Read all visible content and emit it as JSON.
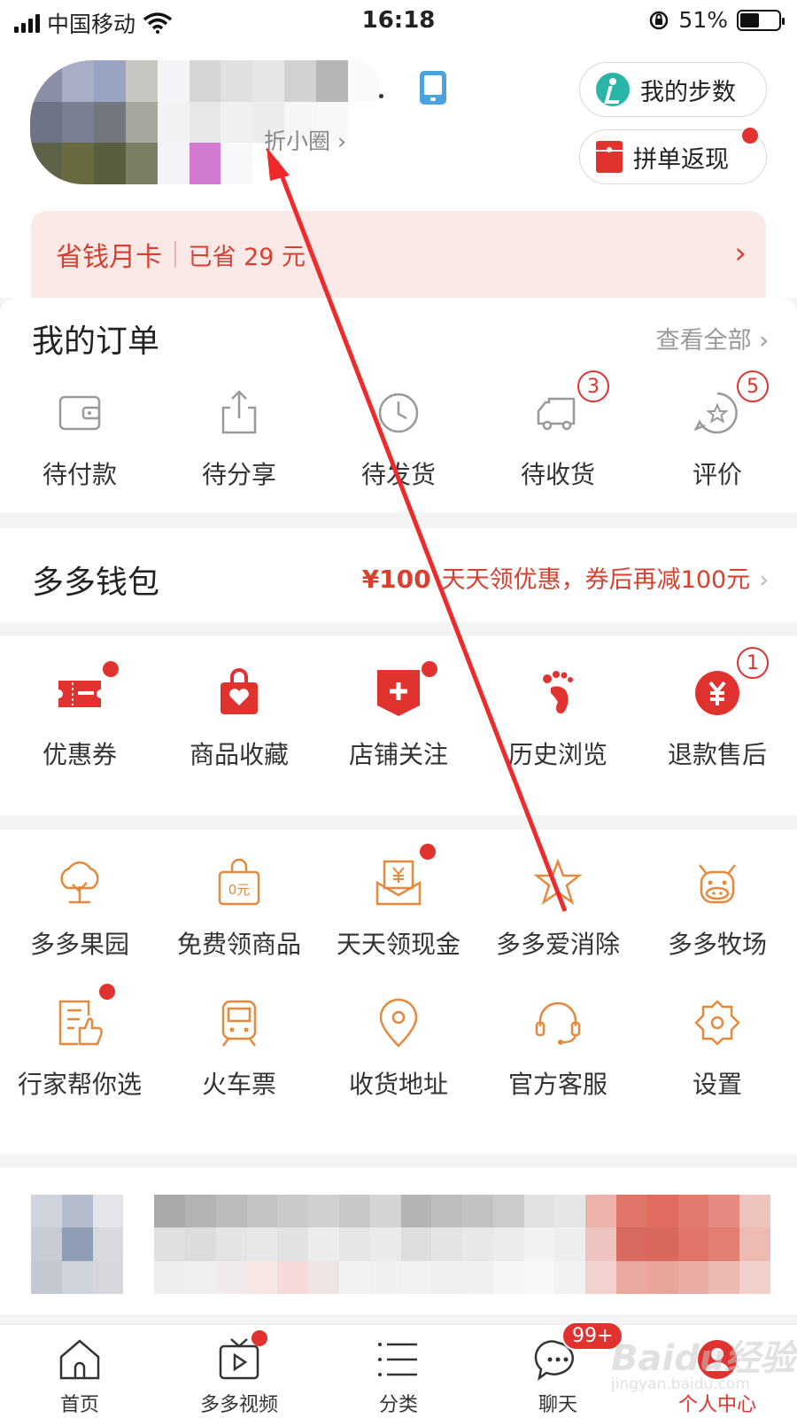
{
  "status_bar": {
    "carrier": "中国移动",
    "time": "16:18",
    "battery": "51%",
    "battery_level": 0.51
  },
  "header": {
    "circle_link": "折小圈 ›",
    "steps_button": "我的步数",
    "rebate_button": "拼单返现"
  },
  "savings_card": {
    "title": "省钱月卡",
    "saved": "已省 29 元"
  },
  "orders": {
    "title": "我的订单",
    "view_all": "查看全部 ›",
    "items": [
      {
        "label": "待付款",
        "icon": "wallet-icon"
      },
      {
        "label": "待分享",
        "icon": "share-icon"
      },
      {
        "label": "待发货",
        "icon": "clock-icon"
      },
      {
        "label": "待收货",
        "icon": "truck-icon",
        "badge": "3"
      },
      {
        "label": "评价",
        "icon": "review-icon",
        "badge": "5"
      }
    ]
  },
  "wallet": {
    "title": "多多钱包",
    "amount": "¥100",
    "promo": "天天领优惠，券后再减100元"
  },
  "tools1": [
    {
      "label": "优惠券",
      "icon": "coupon-icon"
    },
    {
      "label": "商品收藏",
      "icon": "favorite-bag-icon"
    },
    {
      "label": "店铺关注",
      "icon": "store-follow-icon"
    },
    {
      "label": "历史浏览",
      "icon": "footprint-icon"
    },
    {
      "label": "退款售后",
      "icon": "refund-icon",
      "badge": "1"
    }
  ],
  "tools2": [
    {
      "label": "多多果园",
      "icon": "tree-icon"
    },
    {
      "label": "免费领商品",
      "icon": "free-bag-icon"
    },
    {
      "label": "天天领现金",
      "icon": "cash-icon"
    },
    {
      "label": "多多爱消除",
      "icon": "star-icon"
    },
    {
      "label": "多多牧场",
      "icon": "cow-icon"
    },
    {
      "label": "行家帮你选",
      "icon": "expert-pick-icon"
    },
    {
      "label": "火车票",
      "icon": "train-icon"
    },
    {
      "label": "收货地址",
      "icon": "location-icon"
    },
    {
      "label": "官方客服",
      "icon": "headset-icon"
    },
    {
      "label": "设置",
      "icon": "gear-icon"
    }
  ],
  "tabbar": [
    {
      "label": "首页",
      "icon": "home-icon"
    },
    {
      "label": "多多视频",
      "icon": "video-icon"
    },
    {
      "label": "分类",
      "icon": "list-icon"
    },
    {
      "label": "聊天",
      "icon": "chat-icon",
      "badge": "99+"
    },
    {
      "label": "个人中心",
      "icon": "profile-icon",
      "active": true
    }
  ],
  "watermark": {
    "brand": "Baidu经验",
    "url": "jingyan.baidu.com"
  },
  "colors": {
    "accent": "#e0322e",
    "orange_icon": "#e6893c",
    "teal": "#2bb5a8"
  }
}
